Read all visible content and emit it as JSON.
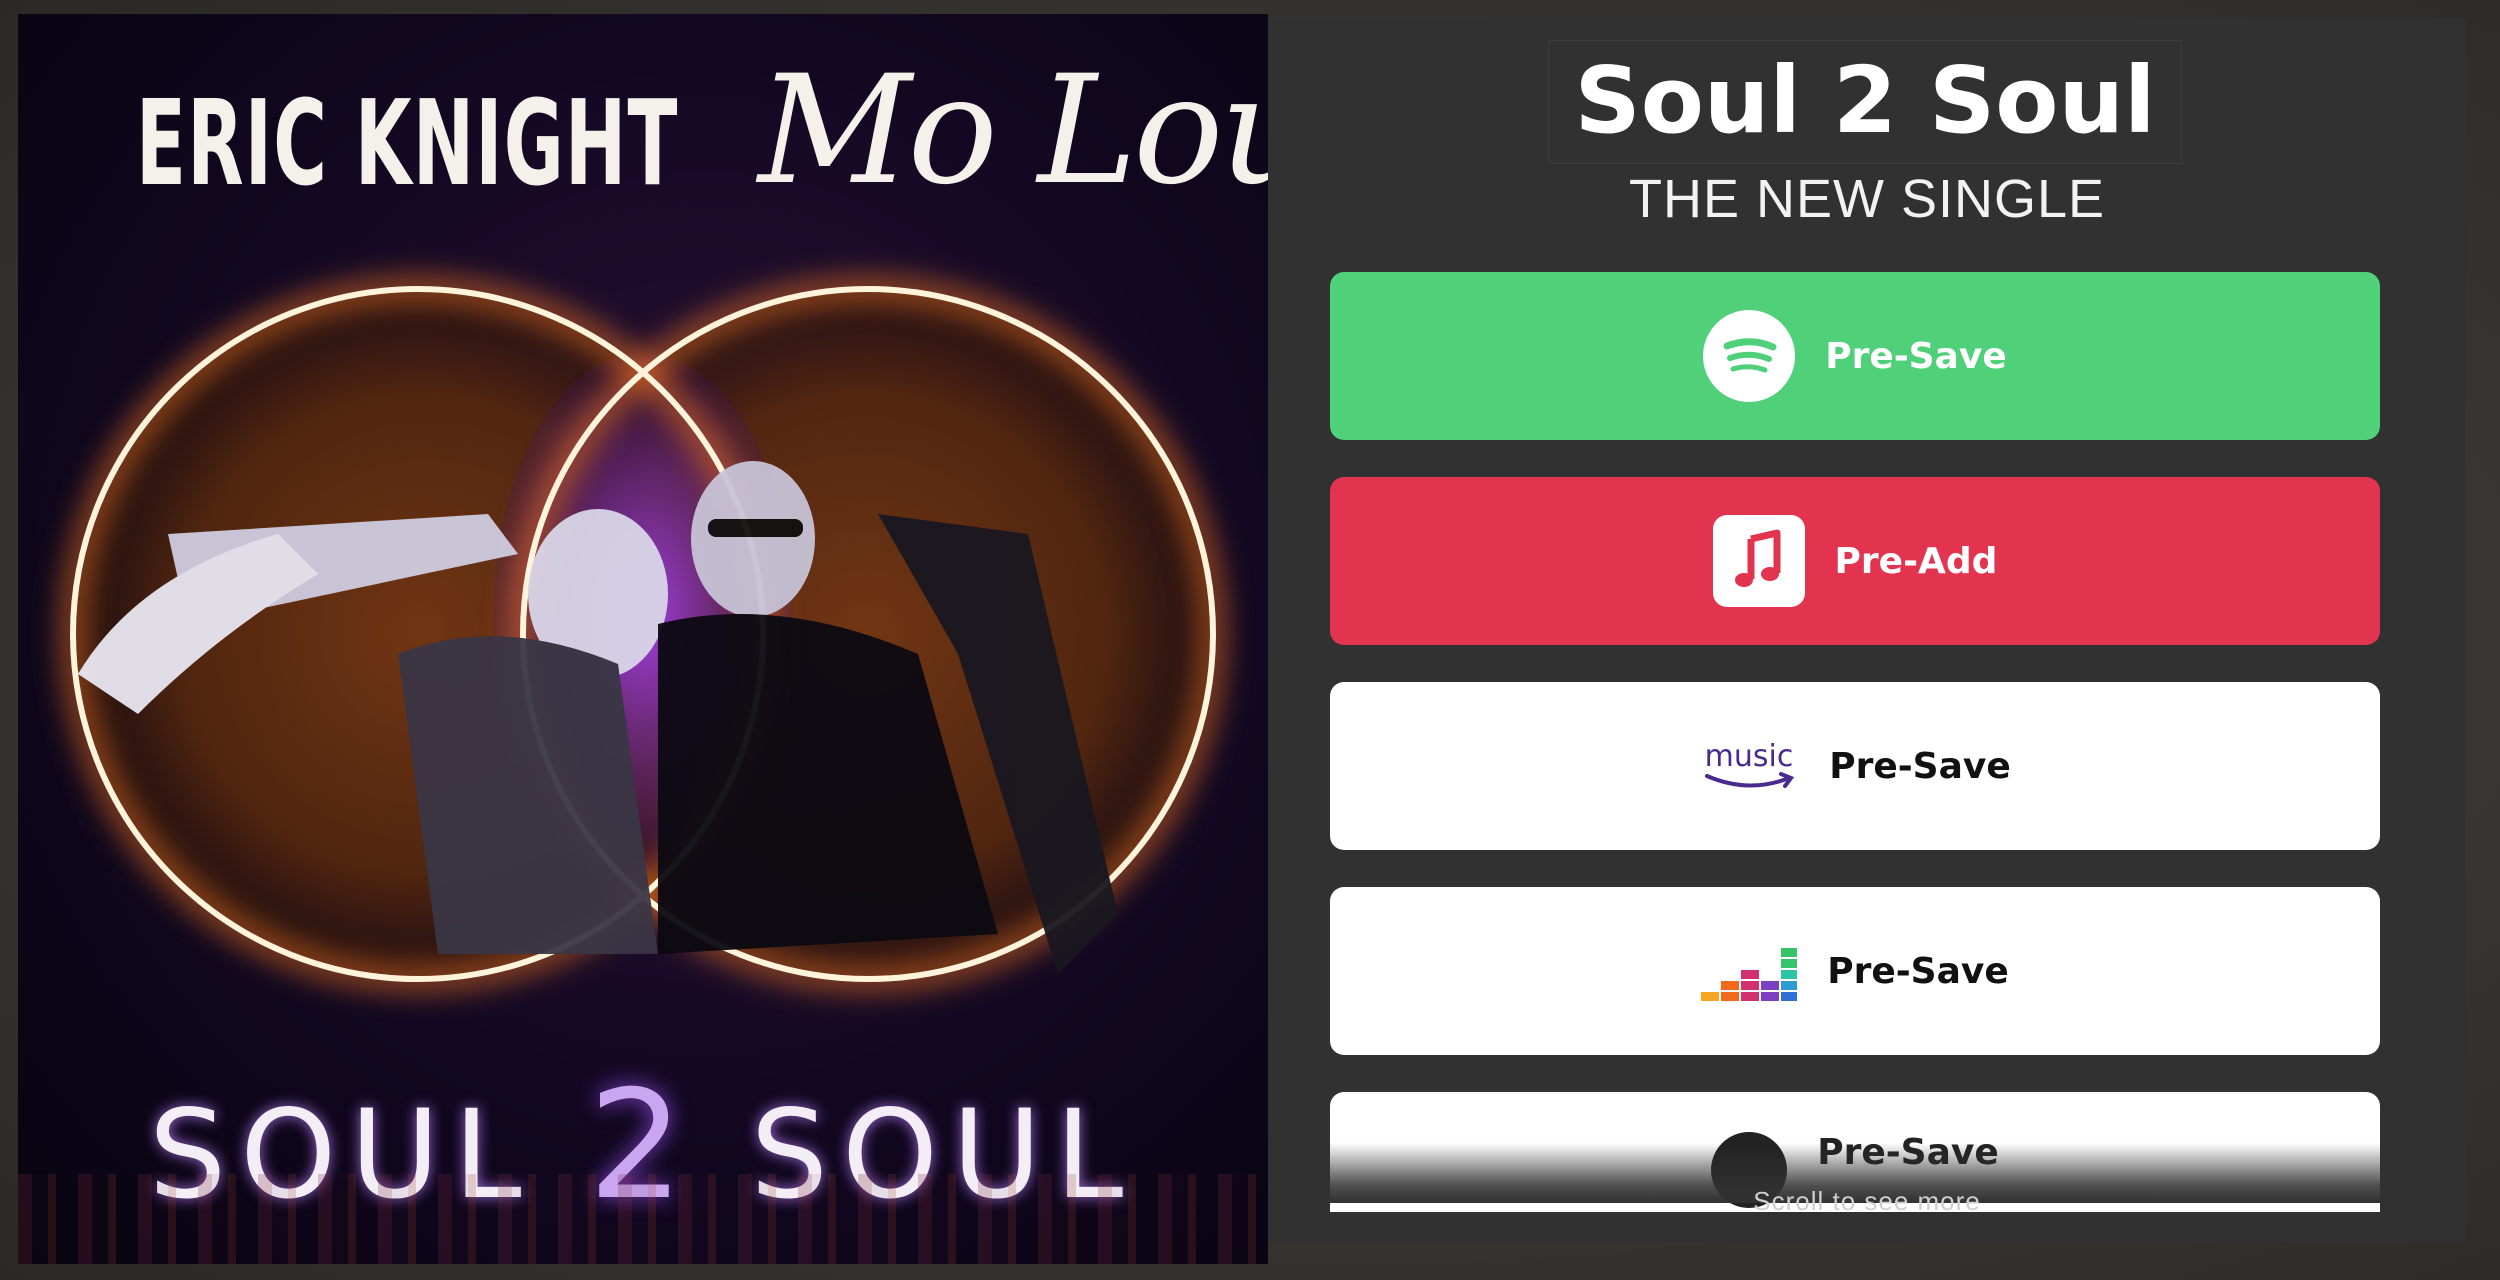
{
  "cover": {
    "artist_left": "ERIC KNIGHT",
    "artist_right": "Mo Louis",
    "album_word_1": "SOUL",
    "album_num": "2",
    "album_word_2": "SOUL"
  },
  "panel": {
    "title": "Soul 2 Soul",
    "subtitle": "THE NEW SINGLE",
    "buttons": [
      {
        "service": "spotify",
        "icon": "spotify-icon",
        "label": "Pre-Save",
        "color": "#4fd079"
      },
      {
        "service": "apple-music",
        "icon": "apple-music-icon",
        "label": "Pre-Add",
        "color": "#e3344f"
      },
      {
        "service": "amazon-music",
        "icon": "amazon-music-icon",
        "icon_text": "music",
        "label": "Pre-Save",
        "color": "#ffffff"
      },
      {
        "service": "deezer",
        "icon": "deezer-icon",
        "label": "Pre-Save",
        "color": "#ffffff"
      },
      {
        "service": "more",
        "icon": "service-icon",
        "label": "Pre-Save",
        "color": "#ffffff"
      }
    ],
    "scroll_hint": "Scroll to see more"
  }
}
